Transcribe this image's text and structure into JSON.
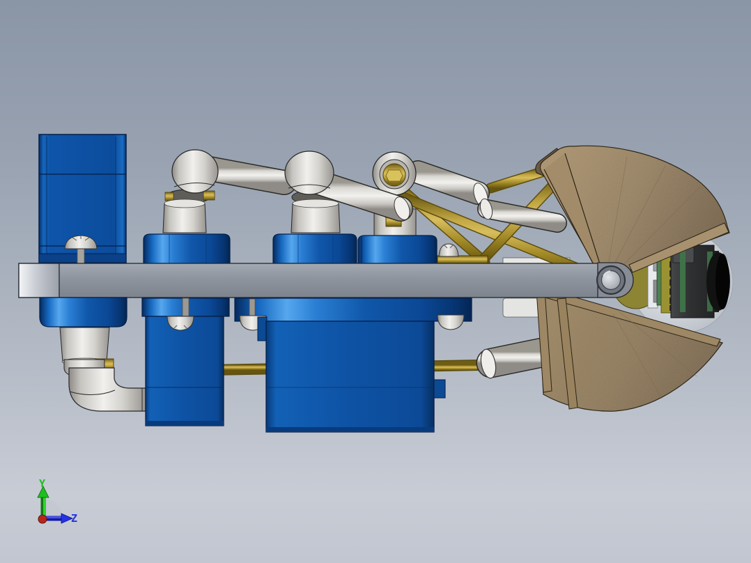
{
  "scene": {
    "type": "cad-3d-viewport",
    "description": "Side view of a servo-driven robotic gripper arm assembly with clamshell scoop jaws gripping a ball with a camera lens module"
  },
  "triad": {
    "y_label": "Y",
    "z_label": "Z",
    "y_axis_color": "#1fbe1f",
    "z_axis_color": "#2433e6",
    "origin_color": "#b3271e",
    "arc_color": "#c3c7cf"
  },
  "palette": {
    "background_top": "#8a95a6",
    "background_bottom": "#c8ccd5",
    "servo_blue": "#1057aa",
    "servo_blue_highlight": "#56a7ee",
    "servo_blue_dark": "#052a5e",
    "beam_gray": "#8e949d",
    "link_gray_light": "#f1f0ed",
    "link_gray": "#d4d2cd",
    "brass_yellow": "#b2952e",
    "jaw_brown": "#8e795c",
    "jaw_brown_dark": "#6a5943",
    "sphere_gray": "#d5d9df",
    "camera_body": "#303233",
    "camera_green": "#47774d",
    "pcb_olive": "#99912f"
  },
  "components": [
    {
      "name": "base-servo-box",
      "color": "#0e55aa"
    },
    {
      "name": "support-beam",
      "color": "#8e949d"
    },
    {
      "name": "servo-motor-1",
      "color": "#0e55aa"
    },
    {
      "name": "servo-motor-2",
      "color": "#0e55aa"
    },
    {
      "name": "servo-motor-3",
      "color": "#0e55aa"
    },
    {
      "name": "elbow-joint-links",
      "color": "#d4d2cd"
    },
    {
      "name": "rod-end-bearing",
      "color": "#d4d2cd"
    },
    {
      "name": "truss-rods",
      "color": "#b2952e"
    },
    {
      "name": "gripper-jaw-upper",
      "color": "#8e795c"
    },
    {
      "name": "gripper-jaw-lower",
      "color": "#8e795c"
    },
    {
      "name": "gripped-ball",
      "color": "#d5d9df"
    },
    {
      "name": "camera-lens-module",
      "color": "#303233"
    }
  ]
}
